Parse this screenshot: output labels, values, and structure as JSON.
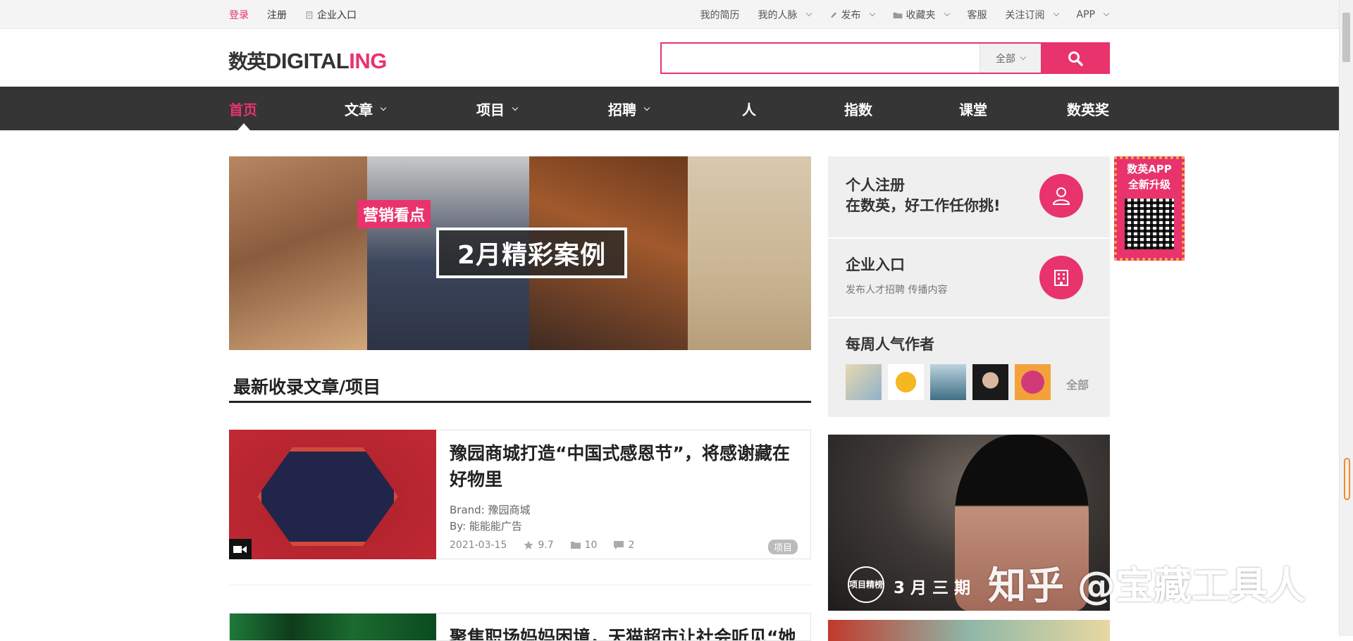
{
  "topbar": {
    "login": "登录",
    "register": "注册",
    "enterprise": "企业入口",
    "resume": "我的简历",
    "contacts": "我的人脉",
    "publish": "发布",
    "favorites": "收藏夹",
    "service": "客服",
    "subscribe": "关注订阅",
    "app": "APP"
  },
  "header": {
    "logo_cn": "数英",
    "logo_en_a": "DIGITAL",
    "logo_en_b": "ING",
    "search_placeholder": "",
    "search_scope": "全部"
  },
  "nav": {
    "items": [
      "首页",
      "文章",
      "项目",
      "招聘",
      "人",
      "指数",
      "课堂",
      "数英奖"
    ]
  },
  "banner": {
    "tag": "营销看点",
    "title": "2月精彩案例"
  },
  "section": {
    "title": "最新收录文章/项目"
  },
  "articles": [
    {
      "title": "豫园商城打造“中国式感恩节”，将感谢藏在好物里",
      "brand": "Brand: 豫园商城",
      "by": "By: 能能能广告",
      "date": "2021-03-15",
      "score": "9.7",
      "collects": "10",
      "comments": "2",
      "badge": "项目"
    },
    {
      "title": "聚焦职场妈妈困境，天猫超市让社会听见“她"
    }
  ],
  "sidebar": {
    "personal_title_1": "个人注册",
    "personal_title_2": "在数英，好工作任你挑!",
    "enterprise_title": "企业入口",
    "enterprise_sub": "发布人才招聘    传播内容",
    "authors_title": "每周人气作者",
    "authors_all": "全部",
    "promo_badge": "项目精榜",
    "promo_issue": "3 月 三 期"
  },
  "qr": {
    "line1": "数英APP",
    "line2": "全新升级"
  },
  "watermark": "知乎 @宝藏工具人",
  "colors": {
    "accent": "#e8336d",
    "nav_bg": "#353535"
  }
}
